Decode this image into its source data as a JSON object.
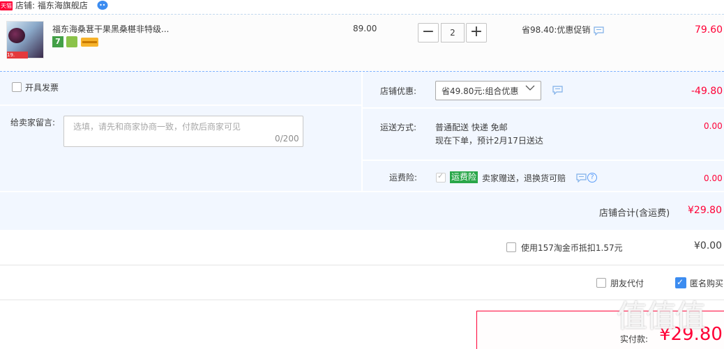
{
  "shop": {
    "badge": "天猫",
    "name": "店铺: 福东海旗舰店"
  },
  "item": {
    "thumb_tag": "19.",
    "title": "福东海桑葚干果黑桑椹非特级...",
    "service_7": "7",
    "price": "89.00",
    "quantity": "2",
    "qty_minus": "−",
    "qty_plus": "+",
    "promo": "省98.40:优惠促销",
    "subtotal": "79.60"
  },
  "invoice": {
    "label": "开具发票"
  },
  "memo": {
    "label": "给卖家留言:",
    "placeholder": "选填，请先和商家协商一致，付款后商家可见",
    "count": "0/200"
  },
  "discount": {
    "label": "店铺优惠:",
    "selected": "省49.80元:组合优惠",
    "amount": "-49.80"
  },
  "shipping": {
    "label": "运送方式:",
    "method": "普通配送 快递 免邮",
    "eta": "现在下单，预计2月17日送达",
    "amount": "0.00"
  },
  "insurance": {
    "label": "运费险:",
    "badge": "运费险",
    "text": "卖家赠送，退换货可赔",
    "help": "?",
    "amount": "0.00"
  },
  "shop_total": {
    "label": "店铺合计(含运费)",
    "value": "¥29.80"
  },
  "coins": {
    "label": "使用157淘金币抵扣1.57元",
    "amount": "¥0.00"
  },
  "friend_pay": {
    "label": "朋友代付"
  },
  "anonymous": {
    "label": "匿名购买",
    "checked": true
  },
  "pay": {
    "label": "实付款:",
    "amount": "¥29.80"
  },
  "watermark": "值值值",
  "colors": {
    "accent_red": "#ff0036",
    "panel_bg": "#f2f7ff",
    "check_blue": "#3c8cf0",
    "insure_green": "#2aa749"
  }
}
